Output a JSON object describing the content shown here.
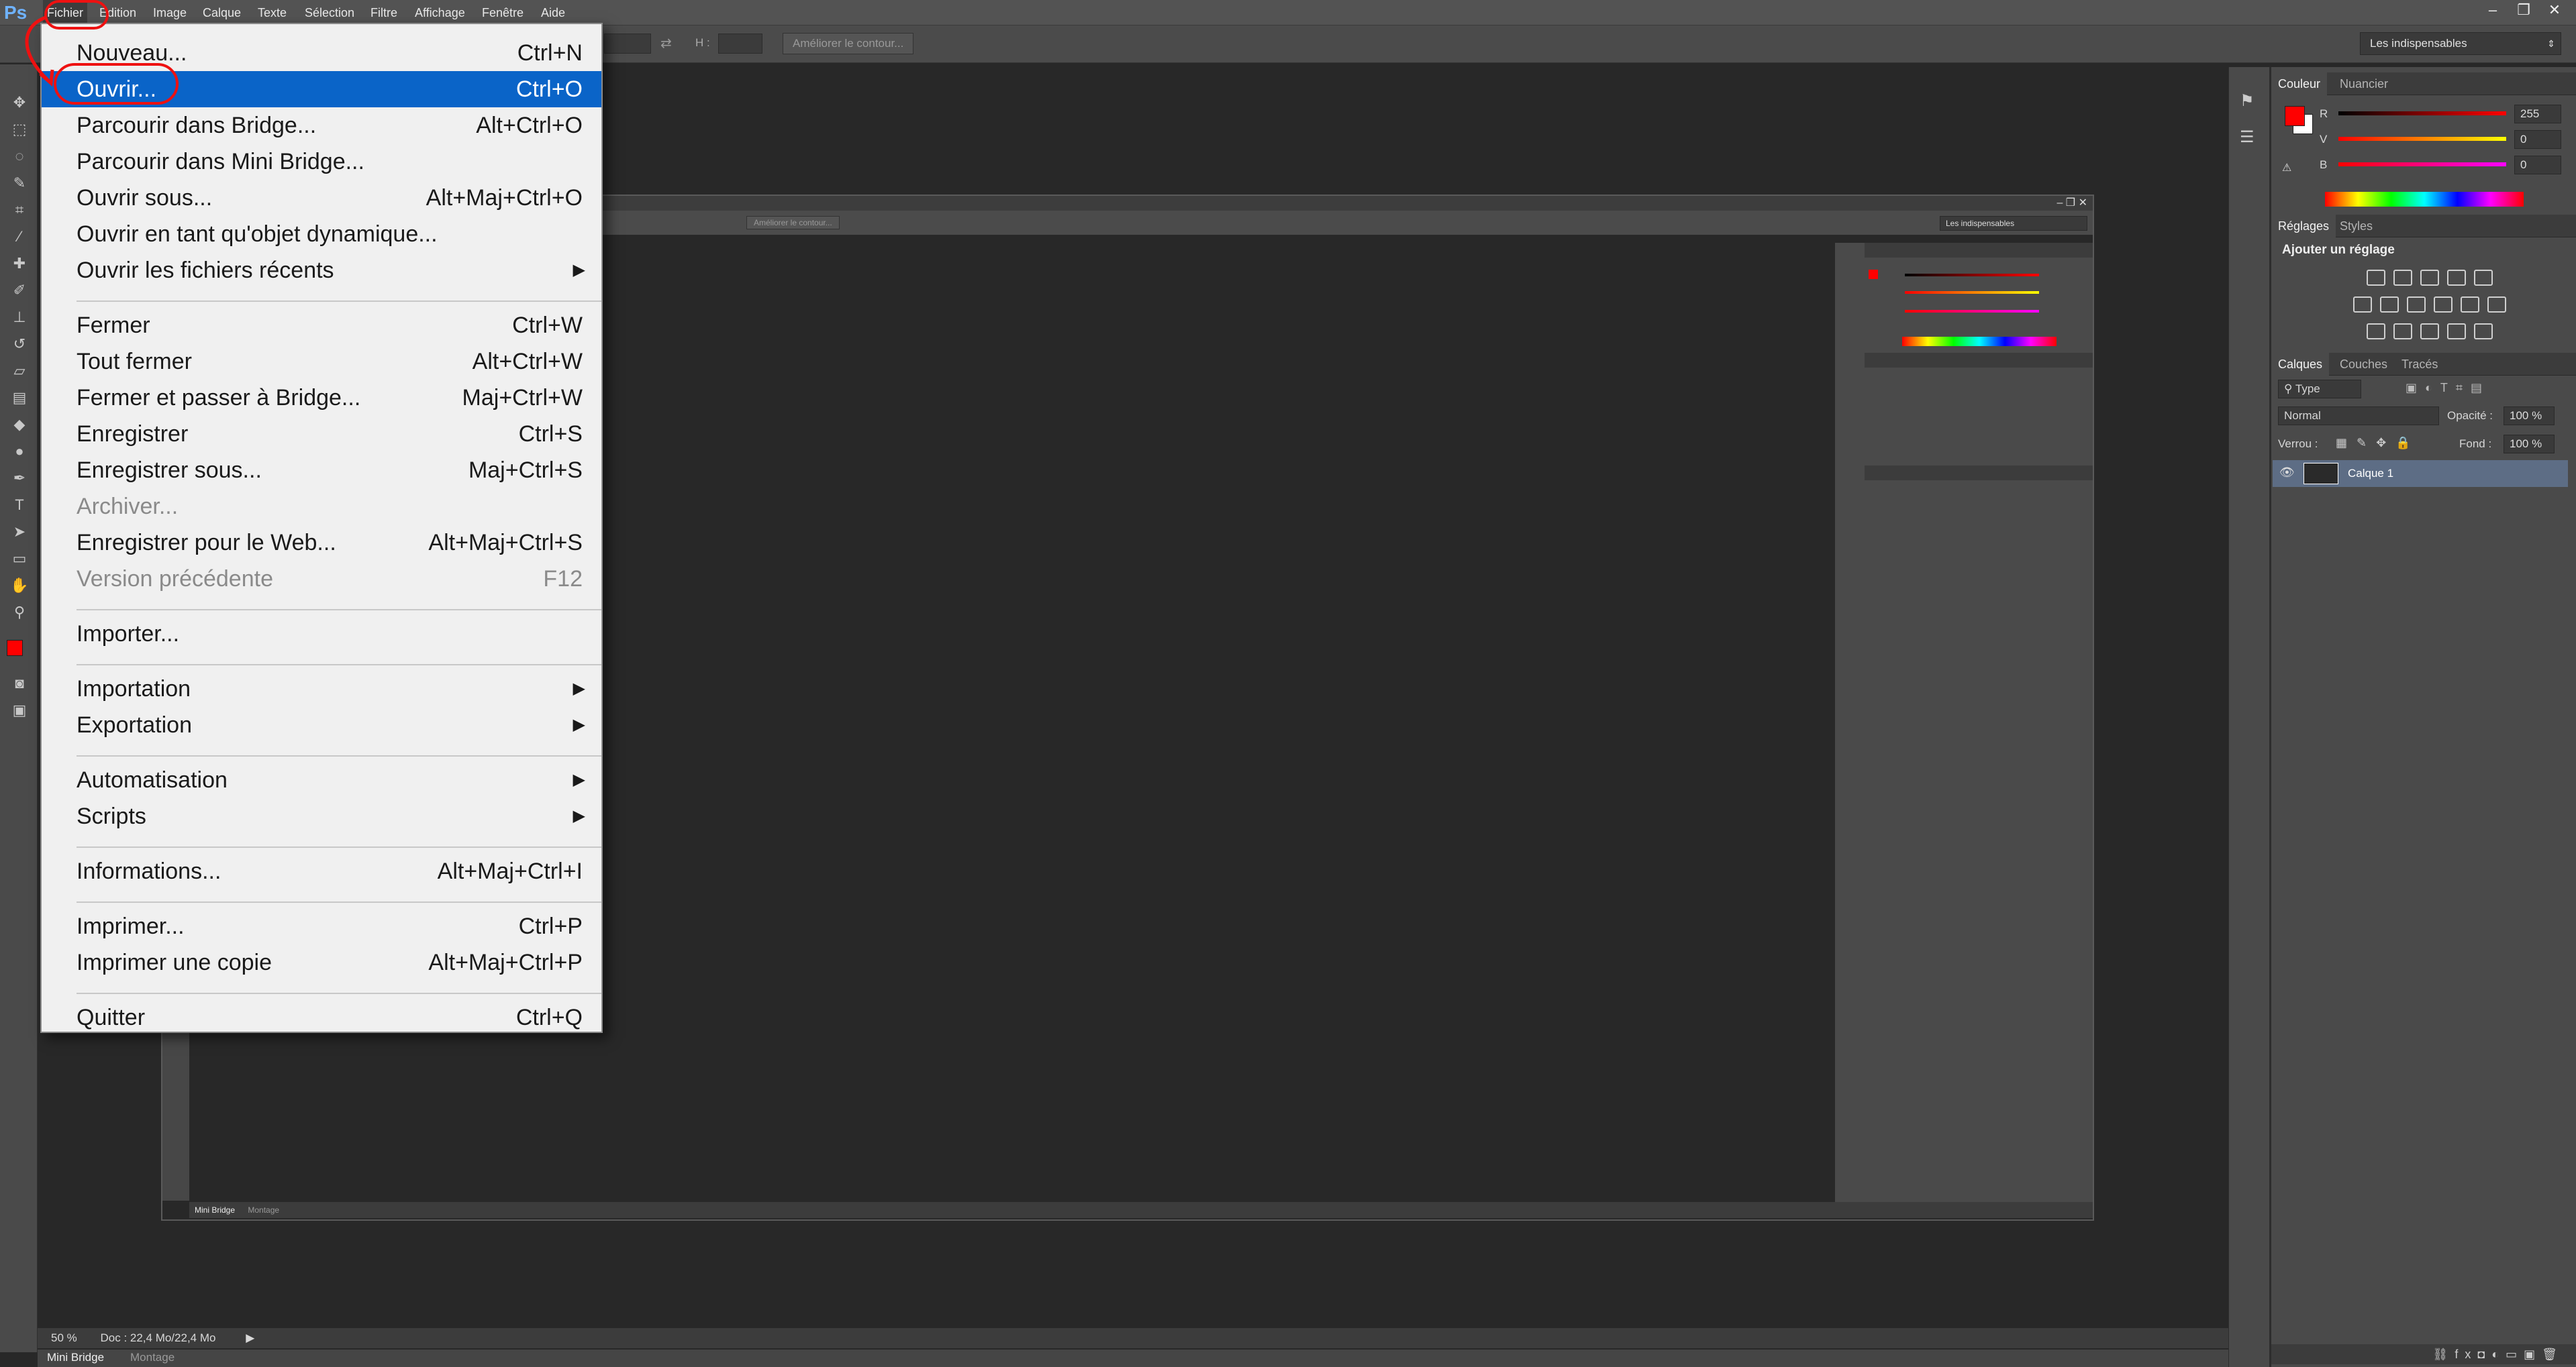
{
  "app": {
    "logo": "Ps"
  },
  "menubar": {
    "items": [
      "Fichier",
      "Edition",
      "Image",
      "Calque",
      "Texte",
      "Sélection",
      "Filtre",
      "Affichage",
      "Fenêtre",
      "Aide"
    ],
    "window_buttons": [
      "–",
      "❐",
      "✕"
    ]
  },
  "options": {
    "height_label": "H :",
    "refine_label": "Améliorer le contour...",
    "workspace": "Les indispensables"
  },
  "file_menu": {
    "items": [
      {
        "label": "Nouveau...",
        "shortcut": "Ctrl+N"
      },
      {
        "label": "Ouvrir...",
        "shortcut": "Ctrl+O",
        "highlighted": true
      },
      {
        "label": "Parcourir dans Bridge...",
        "shortcut": "Alt+Ctrl+O"
      },
      {
        "label": "Parcourir dans Mini Bridge...",
        "shortcut": ""
      },
      {
        "label": "Ouvrir sous...",
        "shortcut": "Alt+Maj+Ctrl+O"
      },
      {
        "label": "Ouvrir en tant qu'objet dynamique...",
        "shortcut": ""
      },
      {
        "label": "Ouvrir les fichiers récents",
        "shortcut": "",
        "submenu": true
      },
      {
        "label": "Fermer",
        "shortcut": "Ctrl+W"
      },
      {
        "label": "Tout fermer",
        "shortcut": "Alt+Ctrl+W"
      },
      {
        "label": "Fermer et passer à Bridge...",
        "shortcut": "Maj+Ctrl+W"
      },
      {
        "label": "Enregistrer",
        "shortcut": "Ctrl+S"
      },
      {
        "label": "Enregistrer sous...",
        "shortcut": "Maj+Ctrl+S"
      },
      {
        "label": "Archiver...",
        "shortcut": "",
        "disabled": true
      },
      {
        "label": "Enregistrer pour le Web...",
        "shortcut": "Alt+Maj+Ctrl+S"
      },
      {
        "label": "Version précédente",
        "shortcut": "F12",
        "disabled": true
      },
      {
        "label": "Importer...",
        "shortcut": ""
      },
      {
        "label": "Importation",
        "shortcut": "",
        "submenu": true
      },
      {
        "label": "Exportation",
        "shortcut": "",
        "submenu": true
      },
      {
        "label": "Automatisation",
        "shortcut": "",
        "submenu": true
      },
      {
        "label": "Scripts",
        "shortcut": "",
        "submenu": true
      },
      {
        "label": "Informations...",
        "shortcut": "Alt+Maj+Ctrl+I"
      },
      {
        "label": "Imprimer...",
        "shortcut": "Ctrl+P"
      },
      {
        "label": "Imprimer une copie",
        "shortcut": "Alt+Maj+Ctrl+P"
      },
      {
        "label": "Quitter",
        "shortcut": "Ctrl+Q"
      }
    ]
  },
  "color_panel": {
    "tabs": [
      "Couleur",
      "Nuancier"
    ],
    "channels": [
      {
        "label": "R",
        "value": "255"
      },
      {
        "label": "V",
        "value": "0"
      },
      {
        "label": "B",
        "value": "0"
      }
    ],
    "foreground": "#ff0000",
    "background": "#ffffff"
  },
  "adjustments_panel": {
    "tabs": [
      "Réglages",
      "Styles"
    ],
    "title": "Ajouter un réglage"
  },
  "layers_panel": {
    "tabs": [
      "Calques",
      "Couches",
      "Tracés"
    ],
    "filter": "Type",
    "blend_mode": "Normal",
    "opacity_label": "Opacité :",
    "opacity_value": "100 %",
    "lock_label": "Verrou :",
    "fill_label": "Fond :",
    "fill_value": "100 %",
    "layers": [
      {
        "name": "Calque 1"
      }
    ]
  },
  "status": {
    "zoom": "50 %",
    "doc": "Doc : 22,4 Mo/22,4 Mo"
  },
  "bottom_tabs": [
    "Mini Bridge",
    "Montage"
  ],
  "nested_bottom_tabs": [
    "Mini Bridge",
    "Montage"
  ],
  "nested_workspace": "Les indispensables",
  "nested_refine": "Améliorer le contour..."
}
